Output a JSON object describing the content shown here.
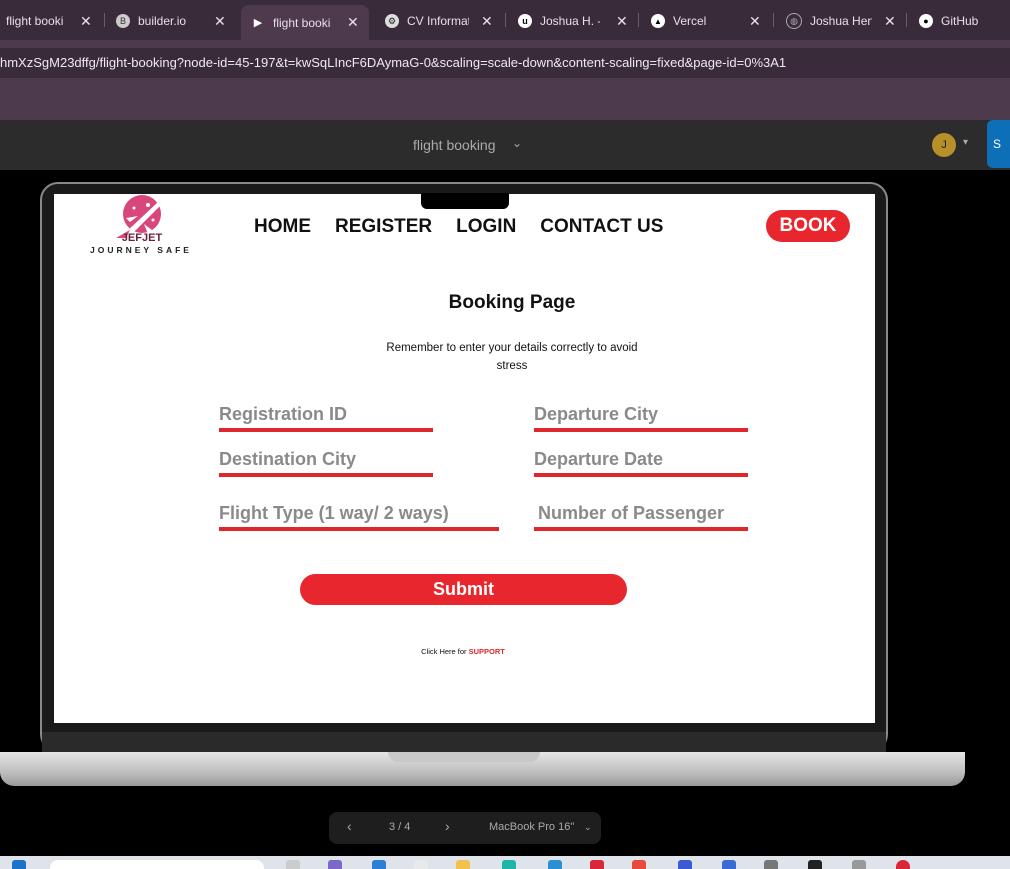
{
  "browser": {
    "tabs": [
      {
        "label": "flight booki",
        "icon": "figma-icon",
        "active": false
      },
      {
        "label": "builder.io",
        "icon": "builder-icon",
        "active": false
      },
      {
        "label": "flight booki",
        "icon": "figma-play-icon",
        "active": true
      },
      {
        "label": "CV Informat",
        "icon": "chatgpt-icon",
        "active": false
      },
      {
        "label": "Joshua H. -",
        "icon": "upwork-icon",
        "active": false
      },
      {
        "label": "Vercel",
        "icon": "vercel-icon",
        "active": false
      },
      {
        "label": "Joshua Hen",
        "icon": "globe-icon",
        "active": false
      },
      {
        "label": "GitHub",
        "icon": "github-icon",
        "active": false
      }
    ],
    "url": "hmXzSgM23dffg/flight-booking?node-id=45-197&t=kwSqLIncF6DAymaG-0&scaling=scale-down&content-scaling=fixed&page-id=0%3A1"
  },
  "figma": {
    "file_name": "flight booking",
    "avatar_initial": "J",
    "share_label": "S",
    "pager": {
      "current": "3 / 4",
      "device": "MacBook Pro 16\""
    }
  },
  "site": {
    "logo": {
      "name": "JEFJET",
      "tagline": "JOURNEY SAFE"
    },
    "nav": [
      "HOME",
      "REGISTER",
      "LOGIN",
      "CONTACT US"
    ],
    "book_button": "BOOK",
    "title": "Booking Page",
    "subtitle": "Remember to enter your details correctly to avoid stress",
    "fields": {
      "registration_id": "Registration ID",
      "departure_city": "Departure City",
      "destination_city": "Destination City",
      "departure_date": "Departure Date",
      "flight_type": "Flight Type (1 way/ 2 ways)",
      "passengers": "Number of Passenger"
    },
    "submit_label": "Submit",
    "support": {
      "prefix": "Click Here for ",
      "link": "SUPPORT"
    }
  },
  "colors": {
    "accent": "#e8262d",
    "browser_bg": "#3a2b3a",
    "field_text": "#8a8a8a"
  }
}
